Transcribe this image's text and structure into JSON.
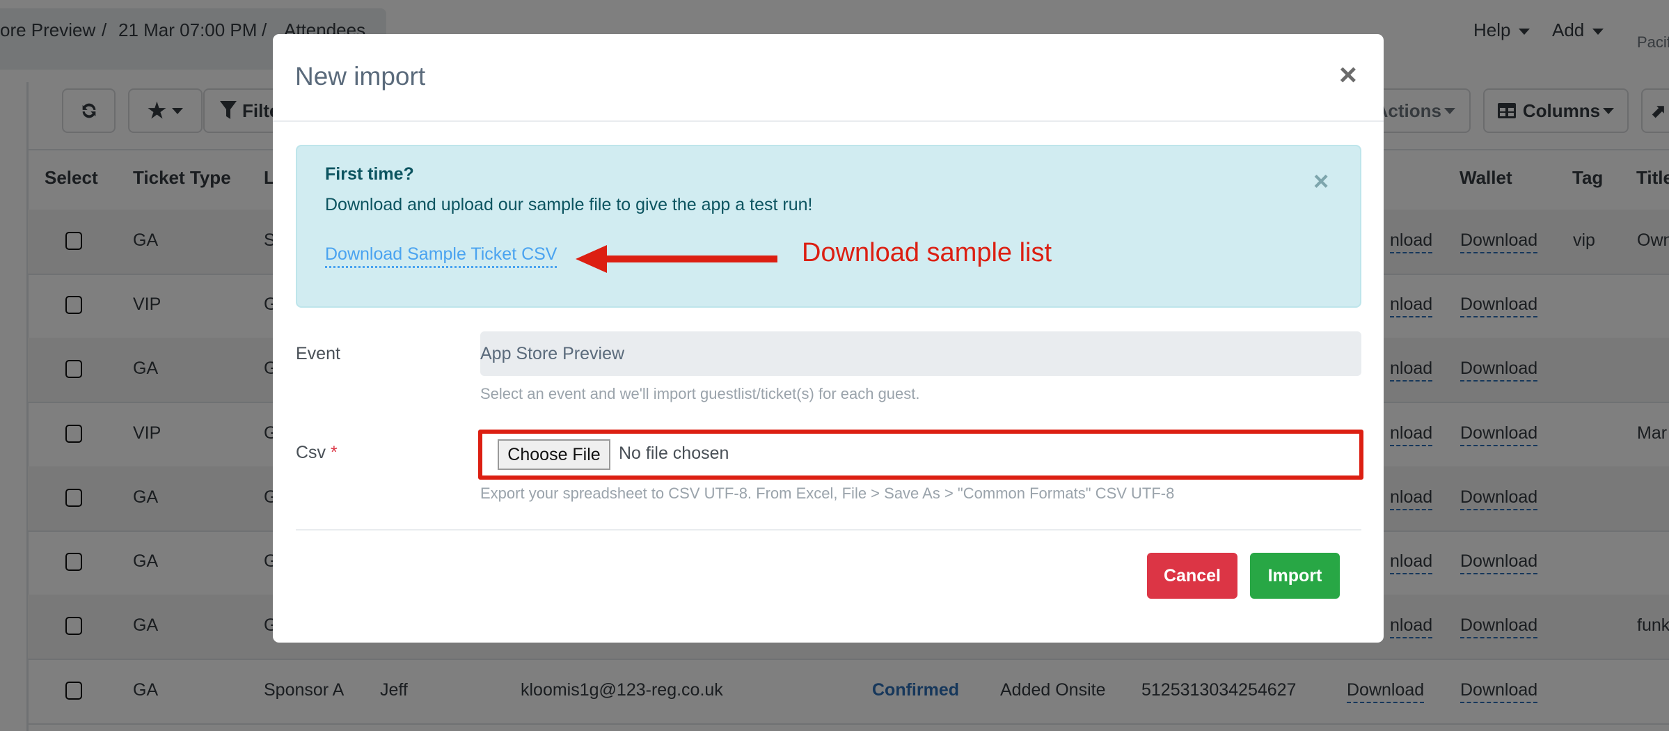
{
  "breadcrumb": {
    "items": [
      "ore Preview",
      "/",
      "21 Mar 07:00 PM",
      "/",
      "Attendees"
    ]
  },
  "topnav": {
    "help": "Help",
    "add": "Add",
    "timezone": "Pacif"
  },
  "toolbar": {
    "refresh_icon": "refresh-icon",
    "favorites_icon": "star-icon",
    "filter_label": "Filte",
    "actions_label": "Actions",
    "columns_label": "Columns"
  },
  "table": {
    "headers": {
      "select": "Select",
      "ticket_type": "Ticket Type",
      "col3": "L",
      "wallet": "Wallet",
      "tag": "Tag",
      "title": "Title"
    },
    "rows": [
      {
        "type": "GA",
        "col3": "S",
        "dl": "nload",
        "wallet": "Download",
        "tag": "vip",
        "title": "Own"
      },
      {
        "type": "VIP",
        "col3": "G",
        "dl": "nload",
        "wallet": "Download",
        "tag": "",
        "title": ""
      },
      {
        "type": "GA",
        "col3": "G",
        "dl": "nload",
        "wallet": "Download",
        "tag": "",
        "title": ""
      },
      {
        "type": "VIP",
        "col3": "G",
        "dl": "nload",
        "wallet": "Download",
        "tag": "",
        "title": "Mar"
      },
      {
        "type": "GA",
        "col3": "G",
        "dl": "nload",
        "wallet": "Download",
        "tag": "",
        "title": ""
      },
      {
        "type": "GA",
        "col3": "G",
        "dl": "nload",
        "wallet": "Download",
        "tag": "",
        "title": ""
      },
      {
        "type": "GA",
        "col3": "G",
        "dl": "nload",
        "wallet": "Download",
        "tag": "",
        "title": "funk"
      },
      {
        "type": "GA",
        "col3": "Sponsor A",
        "name": "Jeff",
        "email": "kloomis1g@123-reg.co.uk",
        "status": "Confirmed",
        "source": "Added Onsite",
        "number": "5125313034254627",
        "dl": "Download",
        "wallet": "Download",
        "tag": "",
        "title": ""
      }
    ]
  },
  "modal": {
    "title": "New import",
    "close": "×",
    "alert": {
      "title": "First time?",
      "text": "Download and upload our sample file to give the app a test run!",
      "link": "Download Sample Ticket CSV",
      "close": "×"
    },
    "annotation": "Download sample list",
    "event": {
      "label": "Event",
      "value": "App Store Preview",
      "help": "Select an event and we'll import guestlist/ticket(s) for each guest."
    },
    "csv": {
      "label": "Csv",
      "required": "*",
      "button": "Choose File",
      "status": "No file chosen",
      "help": "Export your spreadsheet to CSV UTF-8. From Excel, File > Save As > \"Common Formats\" CSV UTF-8"
    },
    "cancel": "Cancel",
    "import": "Import"
  },
  "colors": {
    "cancel": "#dc3545",
    "import": "#28a745",
    "alert_bg": "#d1ecf1",
    "annotation": "#dc1f12",
    "link": "#4aa3f0"
  }
}
